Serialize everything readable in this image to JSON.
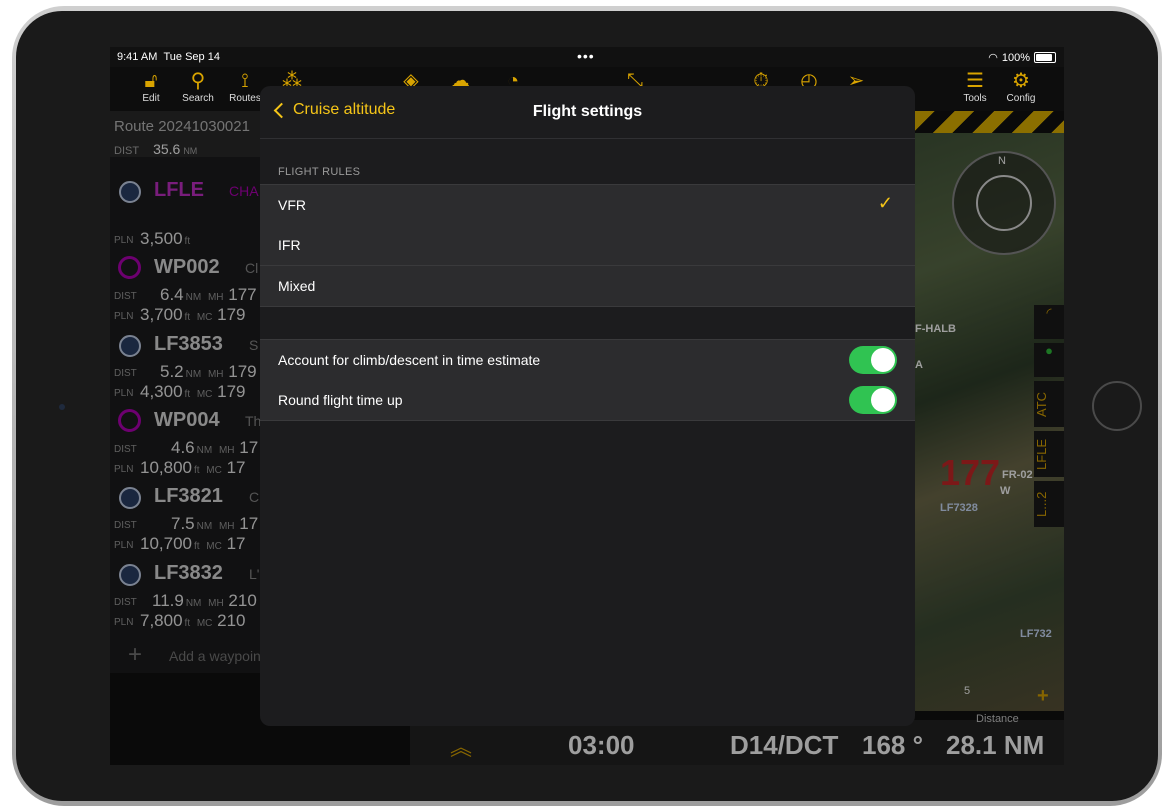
{
  "status": {
    "time": "9:41 AM",
    "date": "Tue Sep 14",
    "battery": "100%"
  },
  "toolbar": {
    "items": [
      {
        "label": "Edit",
        "icon": "lock-open-icon"
      },
      {
        "label": "Search",
        "icon": "search-icon"
      },
      {
        "label": "Routes",
        "icon": "routes-icon"
      },
      {
        "label": "Tools",
        "icon": "menu-icon"
      },
      {
        "label": "Config",
        "icon": "gear-icon"
      }
    ]
  },
  "route": {
    "name": "Route 20241030021",
    "dist_label": "DIST",
    "dist_value": "35.6",
    "dist_unit": "NM",
    "waypoints": [
      {
        "name": "LFLE",
        "sub": "CHA",
        "pln": "3,500"
      },
      {
        "name": "WP002",
        "sub": "Cl",
        "dist": "6.4",
        "mh": "177",
        "pln": "3,700",
        "mc": "179"
      },
      {
        "name": "LF3853",
        "sub": "S",
        "dist": "5.2",
        "mh": "179",
        "pln": "4,300",
        "mc": "179"
      },
      {
        "name": "WP004",
        "sub": "Th",
        "dist": "4.6",
        "mh": "17",
        "pln": "10,800",
        "mc": "17"
      },
      {
        "name": "LF3821",
        "sub": "C",
        "dist": "7.5",
        "mh": "17",
        "pln": "10,700",
        "mc": "17"
      },
      {
        "name": "LF3832",
        "sub": "L'",
        "dist": "11.9",
        "mh": "210",
        "pln": "7,800",
        "mc": "210"
      }
    ],
    "labels": {
      "dist": "DIST",
      "pln": "PLN",
      "mh": "MH",
      "mc": "MC",
      "nm": "NM",
      "ft": "ft"
    },
    "add_waypoint": "Add a waypoint"
  },
  "map": {
    "label_halb": "F-HALB",
    "label_a": "A",
    "label_fr": "FR-02",
    "label_w": "W",
    "label_lf7328": "LF7328",
    "label_lf732": "LF732",
    "big_number": "177",
    "side_tabs": [
      "ATC",
      "LFLE",
      "L...2"
    ],
    "scale": "5",
    "compass_n": "N"
  },
  "bottom": {
    "time": "03:00",
    "route": "D14/DCT",
    "heading": "168 °",
    "distance": "28.1 NM",
    "distance_label": "Distance"
  },
  "sheet": {
    "back_label": "Cruise altitude",
    "title": "Flight settings",
    "section_flight_rules": "FLIGHT RULES",
    "rules": [
      "VFR",
      "IFR",
      "Mixed"
    ],
    "selected_rule": "VFR",
    "toggles": [
      {
        "label": "Account for climb/descent in time estimate",
        "on": true
      },
      {
        "label": "Round flight time up",
        "on": true
      }
    ]
  },
  "colors": {
    "accent": "#f5c518",
    "toggle_on": "#30c352",
    "waypoint_magenta": "#b000b5"
  }
}
